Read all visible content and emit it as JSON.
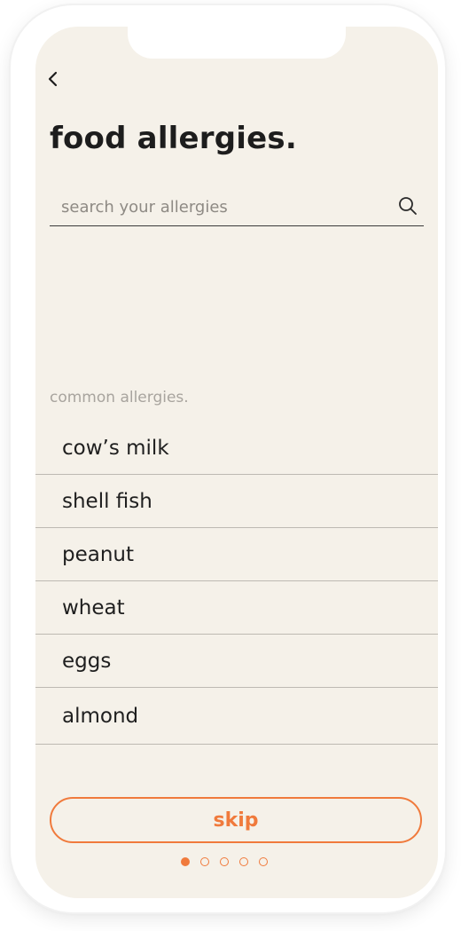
{
  "header": {
    "title": "food allergies."
  },
  "search": {
    "placeholder": "search your allergies",
    "value": ""
  },
  "common": {
    "label": "common allergies.",
    "items": [
      {
        "label": "cow’s milk"
      },
      {
        "label": "shell fish"
      },
      {
        "label": "peanut"
      },
      {
        "label": "wheat"
      },
      {
        "label": "eggs"
      },
      {
        "label": "almond"
      }
    ]
  },
  "footer": {
    "skip_label": "skip",
    "pagination": {
      "current": 1,
      "total": 5
    }
  },
  "colors": {
    "background": "#f5f1e9",
    "accent": "#f07a3c",
    "text": "#1f1f1f",
    "muted": "#a8a49e"
  },
  "icons": [
    "chevron-left-icon",
    "search-icon"
  ]
}
